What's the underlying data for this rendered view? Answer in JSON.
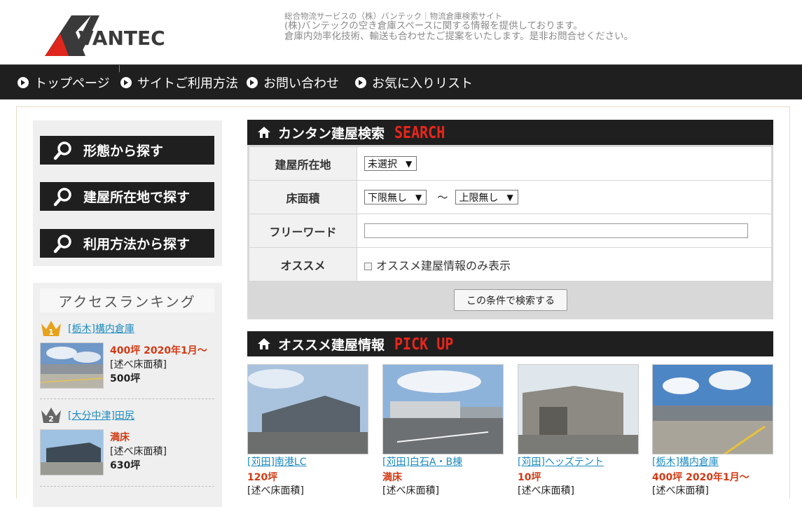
{
  "header": {
    "logo_text": "VANTEC",
    "tagline_small": "総合物流サービスの（株）バンテック｜物流倉庫検索サイト",
    "tagline_1": "(株)バンテックの空き倉庫スペースに関する情報を提供しております。",
    "tagline_2": "倉庫内効率化技術、輸送も合わせたご提案をいたします。是非お問合せください。"
  },
  "nav": {
    "items": [
      {
        "label": "トップページ"
      },
      {
        "label": "サイトご利用方法"
      },
      {
        "label": "お問い合わせ"
      },
      {
        "label": "お気に入りリスト"
      }
    ]
  },
  "sidebar": {
    "buttons": [
      {
        "label": "形態から探す"
      },
      {
        "label": "建屋所在地で探す"
      },
      {
        "label": "利用方法から探す"
      }
    ],
    "ranking_title": "アクセスランキング",
    "ranking": [
      {
        "rank": "1",
        "title": "[栃木]構内倉庫",
        "status": "400坪 2020年1月～",
        "sub_label": "[述べ床面積]",
        "area": "500坪"
      },
      {
        "rank": "2",
        "title": "[大分中津]田尻",
        "status": "満床",
        "sub_label": "[述べ床面積]",
        "area": "630坪"
      }
    ]
  },
  "search": {
    "title": "カンタン建屋検索",
    "title_en": "SEARCH",
    "rows": {
      "location_label": "建屋所在地",
      "location_value": "未選択",
      "floor_label": "床面積",
      "floor_min": "下限無し",
      "floor_tilde": "～",
      "floor_max": "上限無し",
      "keyword_label": "フリーワード",
      "keyword_value": "",
      "recommend_label": "オススメ",
      "recommend_check": "オススメ建屋情報のみ表示"
    },
    "submit_label": "この条件で検索する"
  },
  "pickup": {
    "title": "オススメ建屋情報",
    "title_en": "PICK UP",
    "items": [
      {
        "title": "[苅田]南港LC",
        "status": "120坪",
        "sub_label": "[述べ床面積]"
      },
      {
        "title": "[苅田]白石A・B棟",
        "status": "満床",
        "sub_label": "[述べ床面積]"
      },
      {
        "title": "[苅田]ヘッズテント",
        "status": "10坪",
        "sub_label": "[述べ床面積]"
      },
      {
        "title": "[栃木]構内倉庫",
        "status": "400坪 2020年1月～",
        "sub_label": "[述べ床面積]"
      }
    ]
  },
  "colors": {
    "nav_bg": "#1f1f1f",
    "accent_red": "#d23a14",
    "link_blue": "#1d8bc0",
    "logo_red": "#e0261c"
  }
}
